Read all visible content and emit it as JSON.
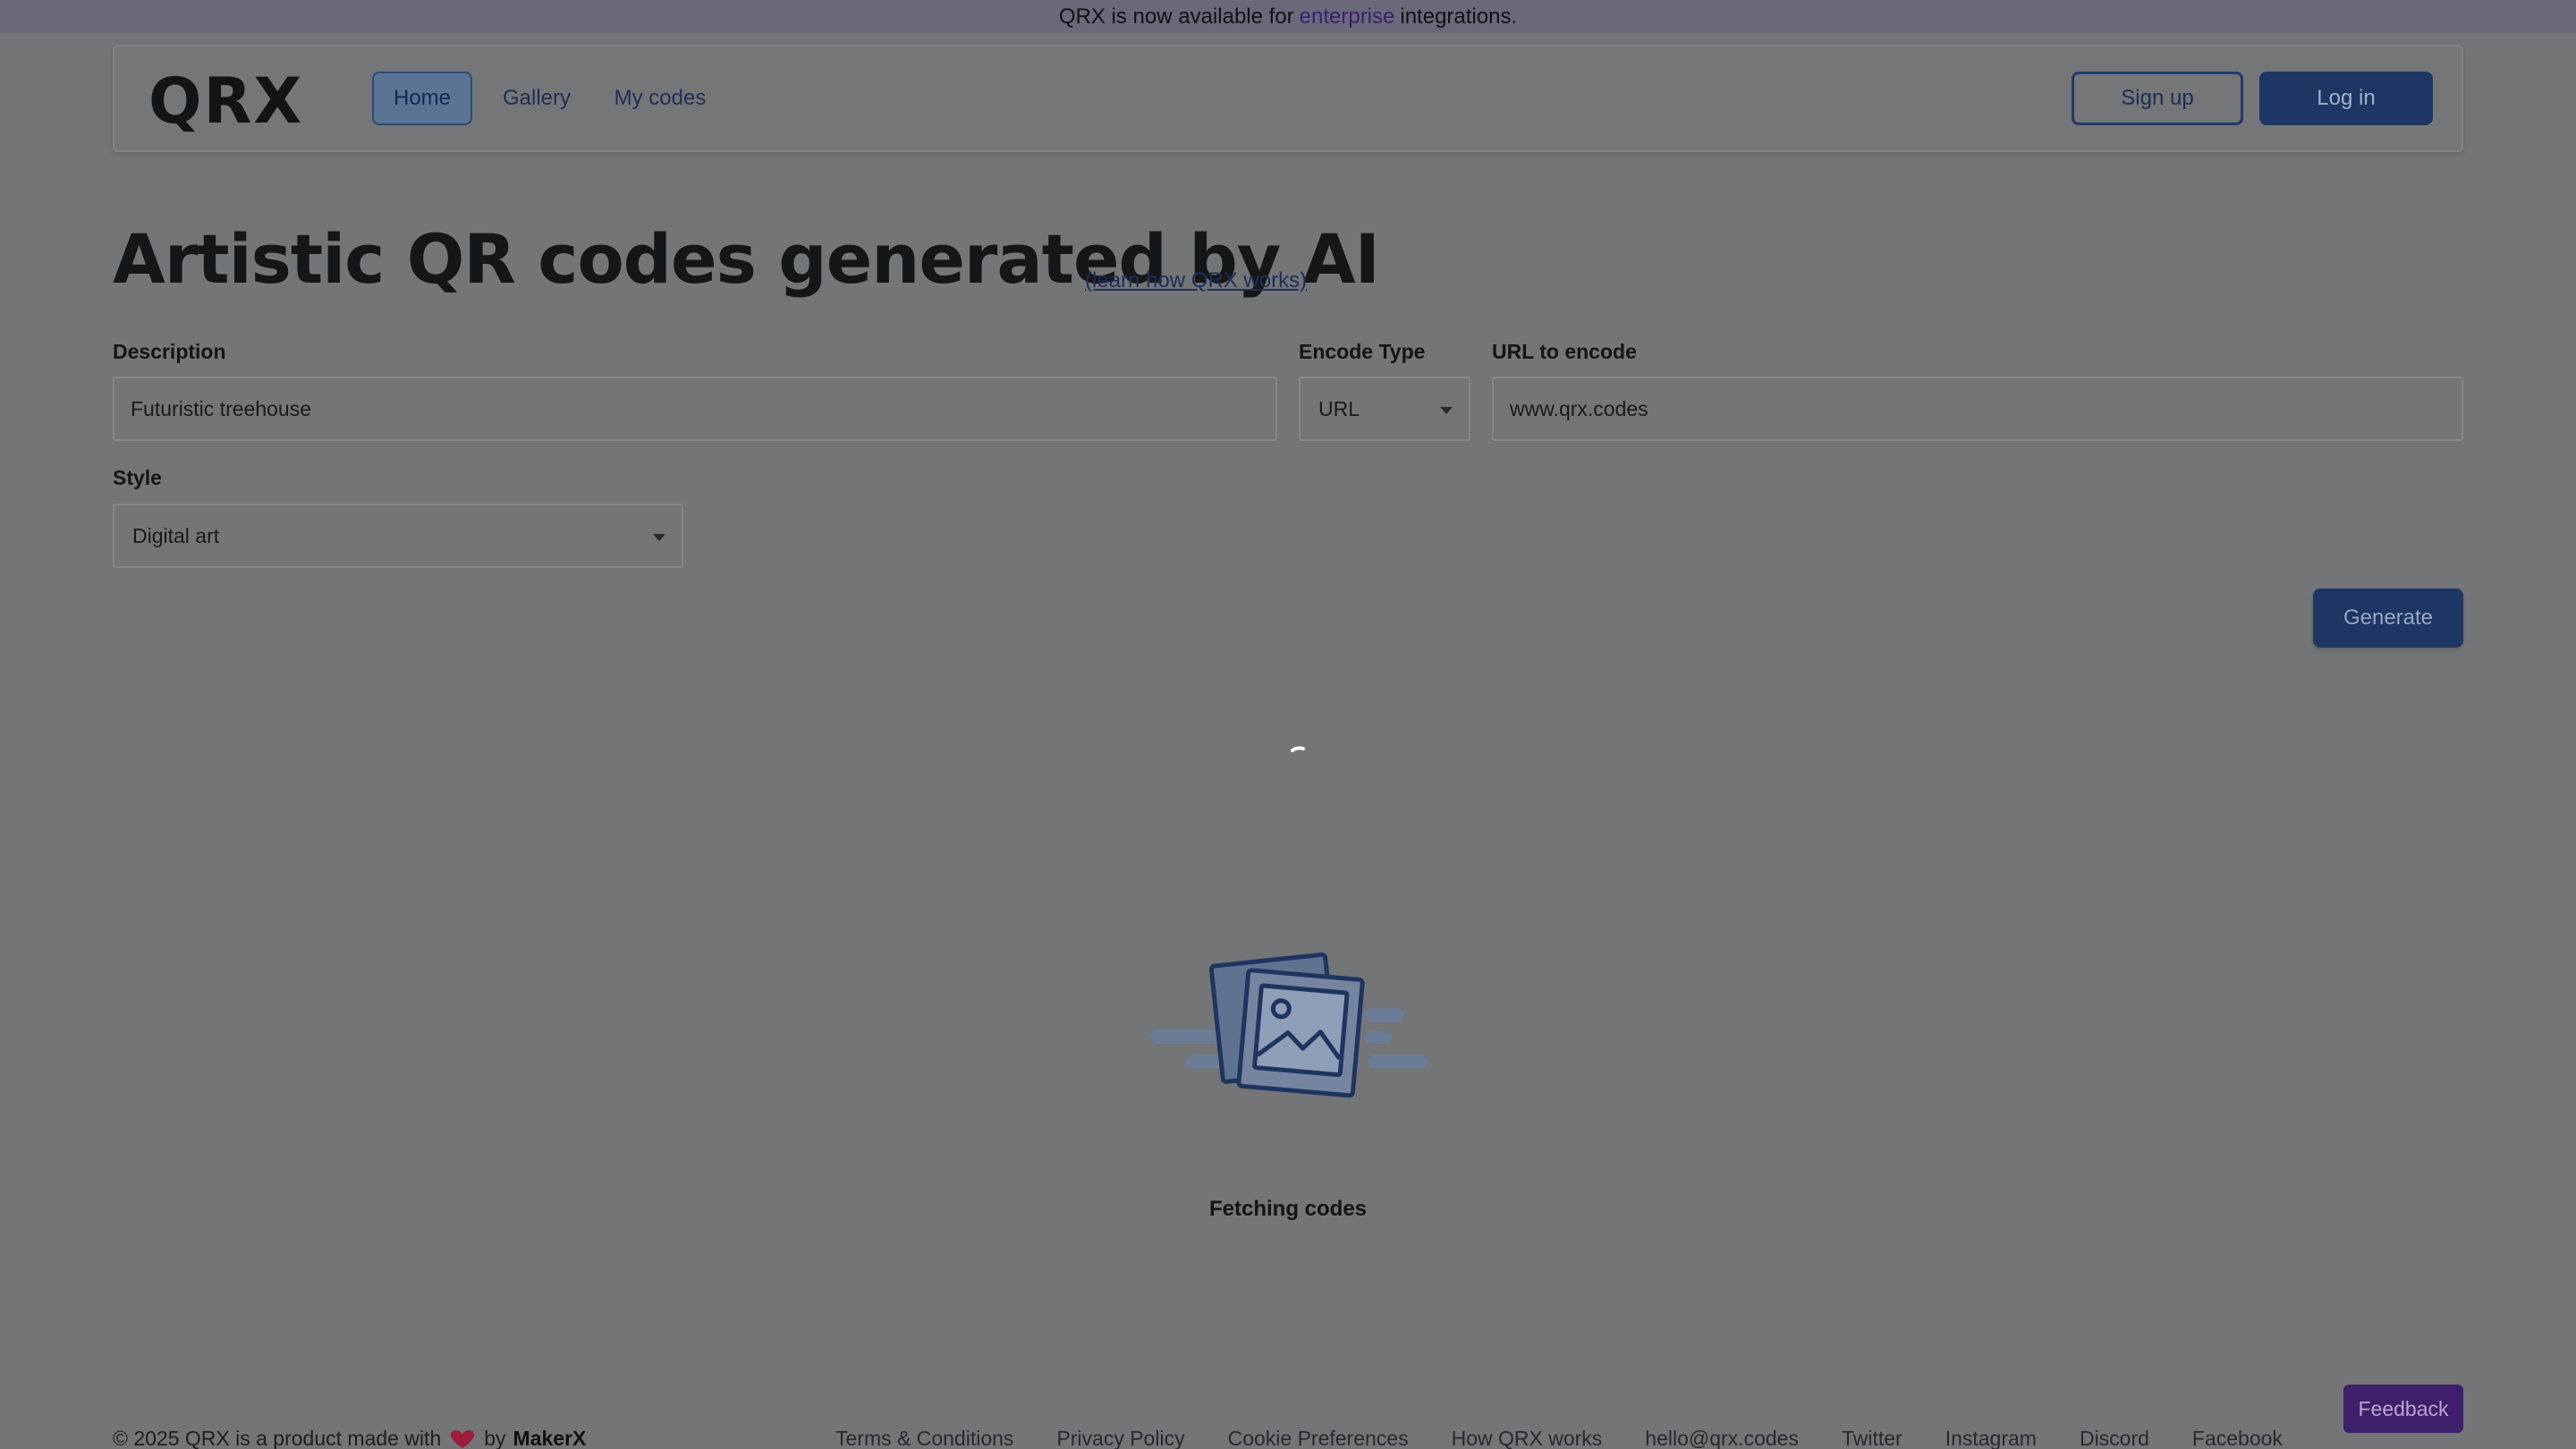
{
  "banner": {
    "text_before": "QRX is now available for",
    "accent_text": "enterprise",
    "text_after": "integrations."
  },
  "nav": {
    "logo": "QRX",
    "links": [
      {
        "label": "Home",
        "active": true
      },
      {
        "label": "Gallery",
        "active": false
      },
      {
        "label": "My codes",
        "active": false
      }
    ],
    "signup_label": "Sign up",
    "login_label": "Log in"
  },
  "hero": {
    "title": "Artistic QR codes generated by AI",
    "learn_link": "(learn how QRX works)"
  },
  "form": {
    "description_label": "Description",
    "description_value": "Futuristic treehouse",
    "encode_type_label": "Encode Type",
    "encode_type_value": "URL",
    "url_label": "URL to encode",
    "url_value": "www.qrx.codes",
    "style_label": "Style",
    "style_value": "Digital art",
    "generate_label": "Generate"
  },
  "status": {
    "fetching_text": "Fetching codes"
  },
  "footer": {
    "copyright_prefix": "© 2025 QRX is a product made with",
    "by_text": "by",
    "brand": "MakerX",
    "links": [
      "Terms & Conditions",
      "Privacy Policy",
      "Cookie Preferences",
      "How QRX works",
      "hello@qrx.codes",
      "Twitter",
      "Instagram",
      "Discord",
      "Facebook"
    ],
    "feedback_label": "Feedback"
  },
  "colors": {
    "overlay_background": "#737576",
    "primary_button": "#1d3663",
    "feedback_button": "#3d1f6a",
    "accent_link": "#3b1f6e"
  },
  "icons": {
    "spinner": "loading-spinner-icon",
    "empty_state": "photo-stack-icon",
    "heart": "heart-icon",
    "dropdown": "caret-down-icon"
  }
}
